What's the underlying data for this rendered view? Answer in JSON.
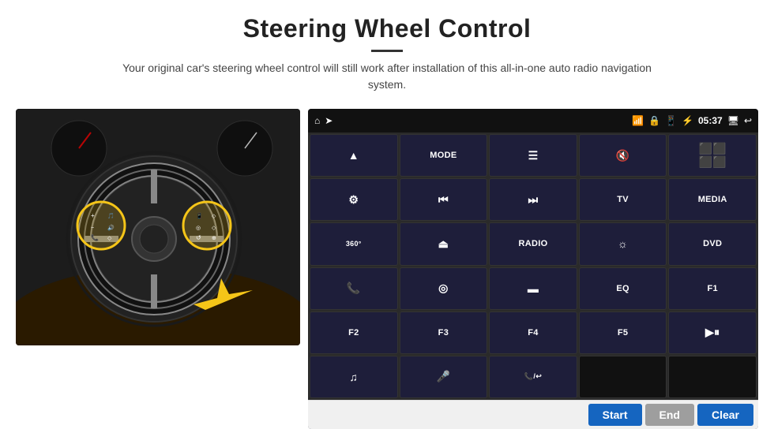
{
  "header": {
    "title": "Steering Wheel Control",
    "underline": true,
    "subtitle": "Your original car's steering wheel control will still work after installation of this all-in-one auto radio navigation system."
  },
  "status_bar": {
    "time": "05:37",
    "icons": [
      "home",
      "wifi",
      "lock",
      "sim",
      "bluetooth",
      "time",
      "screen",
      "back"
    ]
  },
  "button_grid": [
    {
      "id": "r1c1",
      "label": "↑",
      "type": "icon"
    },
    {
      "id": "r1c2",
      "label": "MODE",
      "type": "text"
    },
    {
      "id": "r1c3",
      "label": "☰",
      "type": "icon"
    },
    {
      "id": "r1c4",
      "label": "🔇",
      "type": "icon"
    },
    {
      "id": "r1c5",
      "label": "⬛⬛⬛",
      "type": "icon"
    },
    {
      "id": "r2c1",
      "label": "⚙",
      "type": "icon"
    },
    {
      "id": "r2c2",
      "label": "◀◀",
      "type": "icon"
    },
    {
      "id": "r2c3",
      "label": "▶▶",
      "type": "icon"
    },
    {
      "id": "r2c4",
      "label": "TV",
      "type": "text"
    },
    {
      "id": "r2c5",
      "label": "MEDIA",
      "type": "text"
    },
    {
      "id": "r3c1",
      "label": "360°",
      "type": "text"
    },
    {
      "id": "r3c2",
      "label": "▲",
      "type": "icon"
    },
    {
      "id": "r3c3",
      "label": "RADIO",
      "type": "text"
    },
    {
      "id": "r3c4",
      "label": "☼",
      "type": "icon"
    },
    {
      "id": "r3c5",
      "label": "DVD",
      "type": "text"
    },
    {
      "id": "r4c1",
      "label": "📞",
      "type": "icon"
    },
    {
      "id": "r4c2",
      "label": "◎",
      "type": "icon"
    },
    {
      "id": "r4c3",
      "label": "▬",
      "type": "icon"
    },
    {
      "id": "r4c4",
      "label": "EQ",
      "type": "text"
    },
    {
      "id": "r4c5",
      "label": "F1",
      "type": "text"
    },
    {
      "id": "r5c1",
      "label": "F2",
      "type": "text"
    },
    {
      "id": "r5c2",
      "label": "F3",
      "type": "text"
    },
    {
      "id": "r5c3",
      "label": "F4",
      "type": "text"
    },
    {
      "id": "r5c4",
      "label": "F5",
      "type": "text"
    },
    {
      "id": "r5c5",
      "label": "▶⏸",
      "type": "icon"
    },
    {
      "id": "r6c1",
      "label": "♫",
      "type": "icon"
    },
    {
      "id": "r6c2",
      "label": "🎤",
      "type": "icon"
    },
    {
      "id": "r6c3",
      "label": "📞/↩",
      "type": "icon"
    },
    {
      "id": "r6c4",
      "label": "",
      "type": "empty"
    },
    {
      "id": "r6c5",
      "label": "",
      "type": "empty"
    }
  ],
  "bottom_actions": {
    "start_label": "Start",
    "end_label": "End",
    "clear_label": "Clear"
  }
}
